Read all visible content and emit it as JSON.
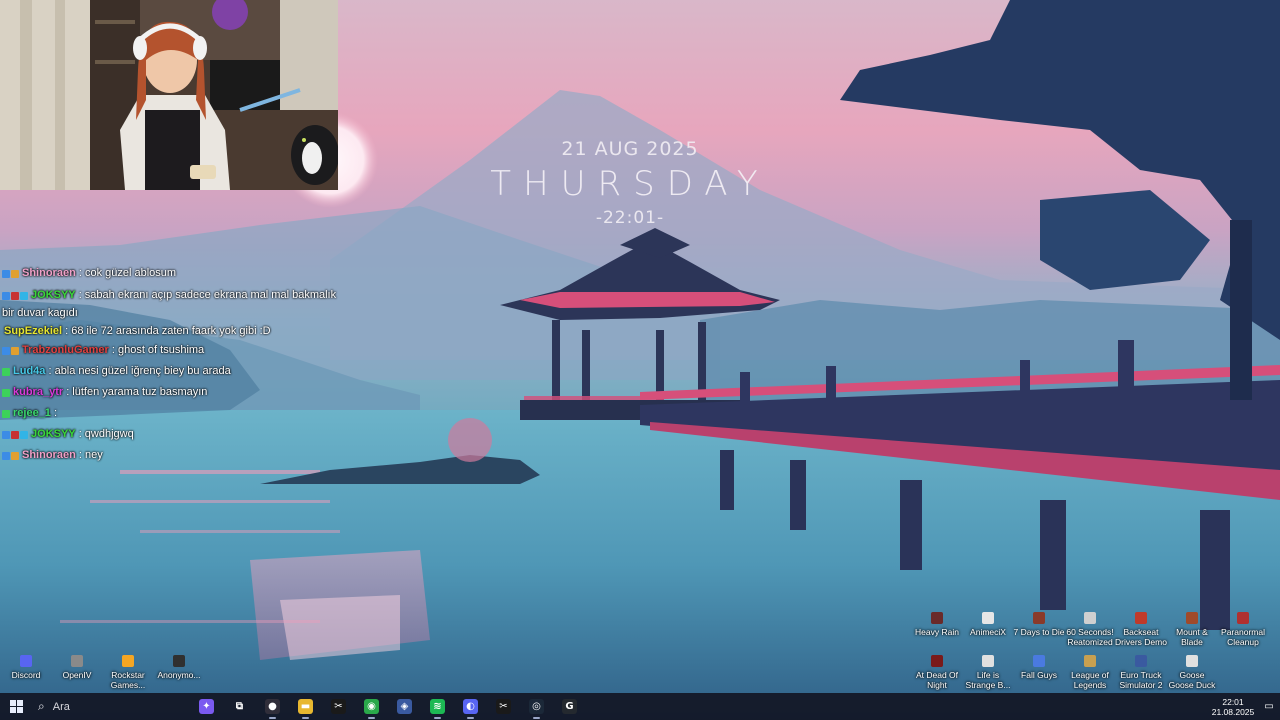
{
  "wallpaper_widget": {
    "date": "21 AUG 2025",
    "day": "THURSDAY",
    "time": "-22:01-"
  },
  "chat": [
    {
      "user": "Shinoraen",
      "user_color": "#f0a0c8",
      "message": " : cok güzel ablosum",
      "badges": [
        "#3c8ce6",
        "#e0a030"
      ]
    },
    {
      "user": "JOKSYY",
      "user_color": "#3ad83a",
      "message": " : sabah ekranı açıp sadece ekrana mal mal bakmalık bir duvar kagıdı",
      "badges": [
        "#3c8ce6",
        "#c83232",
        "#32b4e6"
      ]
    },
    {
      "user": "SupEzekiel",
      "user_color": "#e6e632",
      "message": " : 68 ile 72 arasında zaten faark yok gibi :D",
      "badges": []
    },
    {
      "user": "TrabzonluGamer",
      "user_color": "#e04040",
      "message": " : ghost of tsushima",
      "badges": [
        "#3c8ce6",
        "#e0a030"
      ]
    },
    {
      "user": "Lud4a",
      "user_color": "#46c8e6",
      "message": " : abla nesi güzel iğrenç biey bu arada",
      "badges": [
        "#3cd25a"
      ]
    },
    {
      "user": "kubra_ytr",
      "user_color": "#d83ad8",
      "message": " : lütfen yarama tuz basmayın",
      "badges": [
        "#3cd25a"
      ]
    },
    {
      "user": "rejee_1",
      "user_color": "#3ad86e",
      "message": " : ",
      "badges": [
        "#3cd25a"
      ]
    },
    {
      "user": "JOKSYY",
      "user_color": "#3ad83a",
      "message": " : qwdhjgwq",
      "badges": [
        "#3c8ce6",
        "#c83232",
        "#32b4e6"
      ]
    },
    {
      "user": "Shinoraen",
      "user_color": "#f0a0c8",
      "message": " : ney",
      "badges": [
        "#3c8ce6",
        "#e0a030"
      ]
    }
  ],
  "desktop_icons_left": [
    {
      "label": "Discord",
      "color": "#5865f2"
    },
    {
      "label": "OpenIV",
      "color": "#8a8a8a"
    },
    {
      "label": "Rockstar Games...",
      "color": "#f5a623"
    },
    {
      "label": "Anonymo...",
      "color": "#303030"
    }
  ],
  "desktop_icons_right_row1": [
    {
      "label": "Heavy Rain",
      "color": "#6a2a2a"
    },
    {
      "label": "AnimeciX",
      "color": "#e6e6e6"
    },
    {
      "label": "7 Days to Die",
      "color": "#8a3a2a"
    },
    {
      "label": "60 Seconds! Reatomized",
      "color": "#d0d0d0"
    },
    {
      "label": "Backseat Drivers Demo",
      "color": "#c03a2a"
    },
    {
      "label": "Mount & Blade",
      "color": "#a04a2a"
    },
    {
      "label": "Paranormal Cleanup",
      "color": "#b03030"
    }
  ],
  "desktop_icons_right_row2": [
    {
      "label": "At Dead Of Night",
      "color": "#7a1a1a"
    },
    {
      "label": "Life is Strange B...",
      "color": "#e0e0e0"
    },
    {
      "label": "Fall Guys",
      "color": "#4a7ae0"
    },
    {
      "label": "League of Legends",
      "color": "#c8a050"
    },
    {
      "label": "Euro Truck Simulator 2",
      "color": "#3a5aa0"
    },
    {
      "label": "Goose Goose Duck",
      "color": "#e0e0e0"
    }
  ],
  "taskbar": {
    "search_placeholder": "Ara",
    "apps": [
      {
        "name": "copilot",
        "color": "#7a5af0",
        "glyph": "✦",
        "running": false
      },
      {
        "name": "task-view",
        "color": "transparent",
        "glyph": "⧉",
        "running": false
      },
      {
        "name": "obs",
        "color": "#302e3a",
        "glyph": "●",
        "running": true
      },
      {
        "name": "file-explorer",
        "color": "#e8b830",
        "glyph": "▬",
        "running": true
      },
      {
        "name": "capcut",
        "color": "#1a1a1a",
        "glyph": "✂",
        "running": false
      },
      {
        "name": "chrome",
        "color": "#2aa84a",
        "glyph": "◉",
        "running": true
      },
      {
        "name": "vpn",
        "color": "#3a5aa0",
        "glyph": "◈",
        "running": false
      },
      {
        "name": "spotify",
        "color": "#1db954",
        "glyph": "≋",
        "running": true
      },
      {
        "name": "discord",
        "color": "#5865f2",
        "glyph": "◐",
        "running": true
      },
      {
        "name": "capcut-2",
        "color": "#1a1a1a",
        "glyph": "✂",
        "running": false
      },
      {
        "name": "steam",
        "color": "#1b2838",
        "glyph": "◎",
        "running": true
      },
      {
        "name": "github",
        "color": "#24292f",
        "glyph": "G",
        "running": false
      }
    ],
    "clock_time": "22:01",
    "clock_date": "21.08.2025"
  }
}
